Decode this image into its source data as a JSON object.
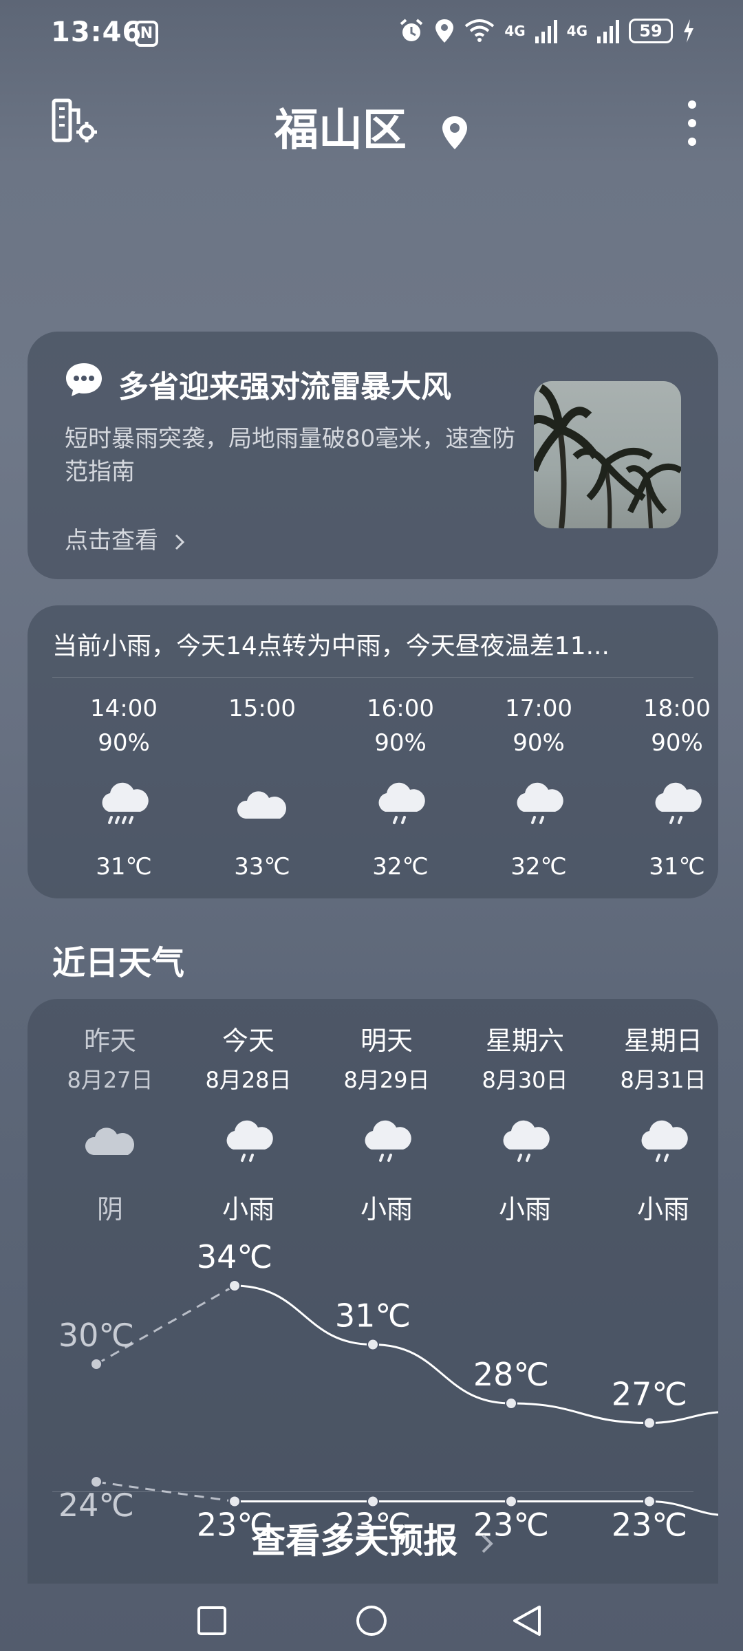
{
  "status_bar": {
    "time": "13:46",
    "nfc_label": "N",
    "network_1": "4G",
    "network_2": "4G",
    "battery": "59"
  },
  "header": {
    "city": "福山区"
  },
  "news": {
    "title": "多省迎来强对流雷暴大风",
    "description": "短时暴雨突袭，局地雨量破80毫米，速查防范指南",
    "link": "点击查看"
  },
  "hourly": {
    "summary": "当前小雨，今天14点转为中雨，今天昼夜温差11...",
    "items": [
      {
        "time": "14:00",
        "precip": "90%",
        "icon": "heavy-rain-icon",
        "temp": "31℃"
      },
      {
        "time": "15:00",
        "precip": "",
        "icon": "cloudy-icon",
        "temp": "33℃"
      },
      {
        "time": "16:00",
        "precip": "90%",
        "icon": "light-rain-icon",
        "temp": "32℃"
      },
      {
        "time": "17:00",
        "precip": "90%",
        "icon": "light-rain-icon",
        "temp": "32℃"
      },
      {
        "time": "18:00",
        "precip": "90%",
        "icon": "light-rain-icon",
        "temp": "31℃"
      }
    ]
  },
  "daily_section_title": "近日天气",
  "daily": {
    "items": [
      {
        "name": "昨天",
        "date": "8月27日",
        "icon": "overcast-icon",
        "condition": "阴"
      },
      {
        "name": "今天",
        "date": "8月28日",
        "icon": "light-rain-icon",
        "condition": "小雨"
      },
      {
        "name": "明天",
        "date": "8月29日",
        "icon": "light-rain-icon",
        "condition": "小雨"
      },
      {
        "name": "星期六",
        "date": "8月30日",
        "icon": "light-rain-icon",
        "condition": "小雨"
      },
      {
        "name": "星期日",
        "date": "8月31日",
        "icon": "light-rain-icon",
        "condition": "小雨"
      }
    ],
    "more_label": "查看多天预报"
  },
  "chart_data": {
    "type": "line",
    "categories": [
      "8月27日",
      "8月28日",
      "8月29日",
      "8月30日",
      "8月31日"
    ],
    "series": [
      {
        "values": [
          30,
          34,
          31,
          28,
          27
        ],
        "labels": [
          "30℃",
          "34℃",
          "31℃",
          "28℃",
          "27℃"
        ]
      },
      {
        "values": [
          24,
          23,
          23,
          23,
          23
        ],
        "labels": [
          "24℃",
          "23℃",
          "23℃",
          "23℃",
          "23℃"
        ]
      }
    ],
    "ylim": [
      20,
      36
    ]
  },
  "colors": {
    "card": "#4a5365",
    "text": "#ffffff",
    "muted": "#c8ccd4"
  }
}
